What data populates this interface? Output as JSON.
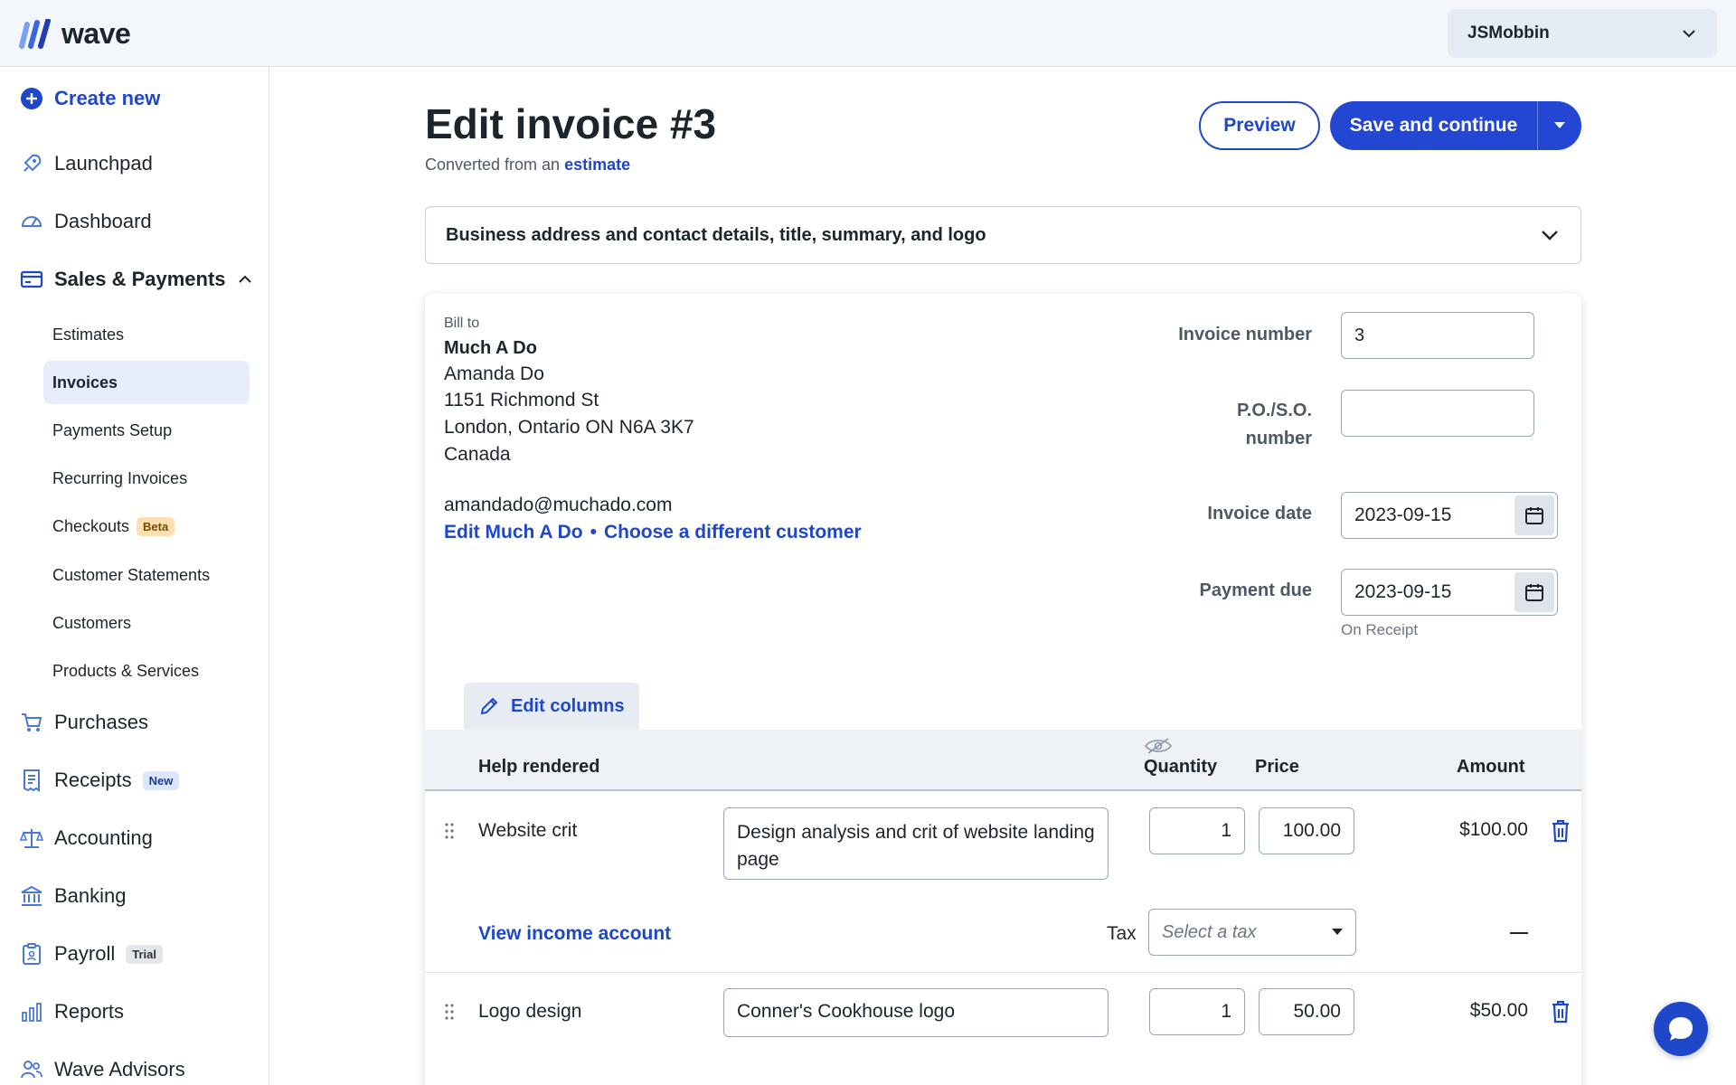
{
  "header": {
    "logo_text": "wave",
    "user_name": "JSMobbin"
  },
  "sidebar": {
    "create_new": "Create new",
    "items": [
      {
        "label": "Launchpad",
        "icon": "rocket-icon"
      },
      {
        "label": "Dashboard",
        "icon": "gauge-icon"
      },
      {
        "label": "Sales & Payments",
        "icon": "card-icon",
        "expanded": true
      },
      {
        "label": "Purchases",
        "icon": "cart-icon"
      },
      {
        "label": "Receipts",
        "icon": "receipt-icon",
        "badge": "New"
      },
      {
        "label": "Accounting",
        "icon": "scale-icon"
      },
      {
        "label": "Banking",
        "icon": "bank-icon"
      },
      {
        "label": "Payroll",
        "icon": "clipboard-icon",
        "badge": "Trial"
      },
      {
        "label": "Reports",
        "icon": "bar-chart-icon"
      },
      {
        "label": "Wave Advisors",
        "icon": "people-icon"
      }
    ],
    "sub_items": [
      {
        "label": "Estimates"
      },
      {
        "label": "Invoices",
        "active": true
      },
      {
        "label": "Payments Setup"
      },
      {
        "label": "Recurring Invoices"
      },
      {
        "label": "Checkouts",
        "badge": "Beta"
      },
      {
        "label": "Customer Statements"
      },
      {
        "label": "Customers"
      },
      {
        "label": "Products & Services"
      }
    ]
  },
  "main": {
    "title": "Edit invoice #3",
    "subtitle_prefix": "Converted from an",
    "subtitle_link": "estimate",
    "preview_label": "Preview",
    "save_label": "Save and continue",
    "accordion_title": "Business address and contact details, title, summary, and logo"
  },
  "invoice": {
    "bill_to_label": "Bill to",
    "customer_name": "Much A Do",
    "contact_name": "Amanda Do",
    "address_line1": "1151 Richmond St",
    "address_line2": "London, Ontario ON N6A 3K7",
    "country": "Canada",
    "email": "amandado@muchado.com",
    "edit_customer_link": "Edit Much A Do",
    "separator": "•",
    "choose_customer_link": "Choose a different customer",
    "invoice_number_label": "Invoice number",
    "invoice_number": "3",
    "po_label_line1": "P.O./S.O.",
    "po_label_line2": "number",
    "po_value": "",
    "invoice_date_label": "Invoice date",
    "invoice_date": "2023-09-15",
    "payment_due_label": "Payment due",
    "payment_due": "2023-09-15",
    "payment_terms": "On Receipt"
  },
  "table": {
    "edit_columns_label": "Edit columns",
    "columns": {
      "items": "Help rendered",
      "quantity": "Quantity",
      "price": "Price",
      "amount": "Amount"
    },
    "rows": [
      {
        "name": "Website crit",
        "description": "Design analysis and crit of website landing page",
        "quantity": "1",
        "price": "100.00",
        "amount": "$100.00",
        "income_link": "View income account",
        "tax_label": "Tax",
        "tax_placeholder": "Select a tax",
        "tax_amount": "—"
      },
      {
        "name": "Logo design",
        "description": "Conner's Cookhouse logo",
        "quantity": "1",
        "price": "50.00",
        "amount": "$50.00"
      }
    ]
  },
  "colors": {
    "primary": "#2346d3",
    "link": "#1f47c9",
    "text": "#1c252c",
    "active_bg": "#e6eefc"
  }
}
